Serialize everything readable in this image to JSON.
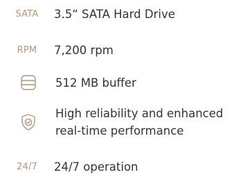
{
  "accent_color": "#b8957a",
  "features": [
    {
      "badge": "SATA",
      "text": "3.5“ SATA Hard Drive"
    },
    {
      "badge": "RPM",
      "text": "7,200 rpm"
    },
    {
      "icon": "database-icon",
      "text": "512 MB buffer"
    },
    {
      "icon": "shield-check-icon",
      "text_lines": [
        "High reliability and enhanced",
        "real-time performance"
      ]
    },
    {
      "badge": "24/7",
      "text": "24/7 operation"
    }
  ]
}
